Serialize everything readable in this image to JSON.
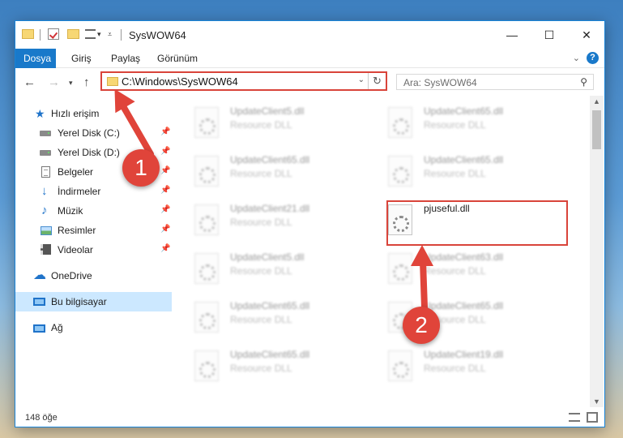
{
  "window": {
    "title": "SysWOW64",
    "controls": {
      "minimize": "—",
      "maximize": "☐",
      "close": "✕"
    }
  },
  "ribbon": {
    "tabs": [
      {
        "label": "Dosya",
        "active": true
      },
      {
        "label": "Giriş",
        "active": false
      },
      {
        "label": "Paylaş",
        "active": false
      },
      {
        "label": "Görünüm",
        "active": false
      }
    ],
    "help": "?"
  },
  "address": {
    "path": "C:\\Windows\\SysWOW64",
    "search_placeholder": "Ara: SysWOW64"
  },
  "nav": {
    "items": [
      {
        "label": "Hızlı erişim",
        "icon": "star-icon",
        "pinned": false
      },
      {
        "label": "Yerel Disk (C:)",
        "icon": "drive-icon",
        "pinned": true
      },
      {
        "label": "Yerel Disk (D:)",
        "icon": "drive-icon",
        "pinned": true
      },
      {
        "label": "Belgeler",
        "icon": "document-icon",
        "pinned": true
      },
      {
        "label": "İndirmeler",
        "icon": "download-icon",
        "pinned": true
      },
      {
        "label": "Müzik",
        "icon": "music-icon",
        "pinned": true
      },
      {
        "label": "Resimler",
        "icon": "pictures-icon",
        "pinned": true
      },
      {
        "label": "Videolar",
        "icon": "videos-icon",
        "pinned": true
      },
      {
        "label": "OneDrive",
        "icon": "cloud-icon",
        "pinned": false
      },
      {
        "label": "Bu bilgisayar",
        "icon": "computer-icon",
        "pinned": false,
        "selected": true
      },
      {
        "label": "Ağ",
        "icon": "network-icon",
        "pinned": false
      }
    ]
  },
  "files": [
    {
      "name": "UpdateClient5.dll",
      "type": "Resource DLL"
    },
    {
      "name": "UpdateClient65.dll",
      "type": "Resource DLL"
    },
    {
      "name": "UpdateClient65.dll",
      "type": "Resource DLL"
    },
    {
      "name": "UpdateClient65.dll",
      "type": "Resource DLL"
    },
    {
      "name": "UpdateClient21.dll",
      "type": "Resource DLL"
    },
    {
      "name": "pjuseful.dll",
      "type": ""
    },
    {
      "name": "UpdateClient5.dll",
      "type": "Resource DLL"
    },
    {
      "name": "UpdateClient63.dll",
      "type": "Resource DLL"
    },
    {
      "name": "UpdateClient65.dll",
      "type": "Resource DLL"
    },
    {
      "name": "UpdateClient65.dll",
      "type": "Resource DLL"
    },
    {
      "name": "UpdateClient65.dll",
      "type": "Resource DLL"
    },
    {
      "name": "UpdateClient19.dll",
      "type": "Resource DLL"
    }
  ],
  "status": {
    "count": "148 öğe"
  },
  "annotations": {
    "step1": "1",
    "step2": "2",
    "color": "#e0443a"
  }
}
